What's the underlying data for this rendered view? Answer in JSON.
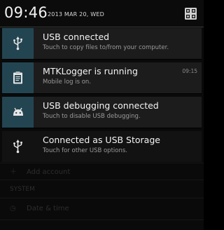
{
  "status_header": {
    "time": "09:46",
    "date": "2013 MAR 20, WED",
    "settings_icon": "quick-settings-grid-icon"
  },
  "notifications": [
    {
      "title": "USB connected",
      "subtitle": "Touch to copy files to/from your computer.",
      "icon": "usb-icon",
      "time": ""
    },
    {
      "title": "MTKLogger is running",
      "subtitle": "Mobile log is on.",
      "icon": "log-clipboard-icon",
      "time": "09:15"
    },
    {
      "title": "USB debugging connected",
      "subtitle": "Touch to disable USB debugging.",
      "icon": "android-debug-icon",
      "time": ""
    },
    {
      "title": "Connected as USB Storage",
      "subtitle": "Touch for other USB options.",
      "icon": "usb-icon",
      "time": ""
    }
  ],
  "background_settings": [
    {
      "label": "Add account",
      "icon": "plus-icon"
    },
    {
      "label": "SYSTEM",
      "icon": ""
    },
    {
      "label": "Date & time",
      "icon": "clock-icon"
    }
  ],
  "colors": {
    "icon_box": "#234552",
    "notification_bg": "#1c1c1c",
    "background": "#0a0a0a"
  }
}
